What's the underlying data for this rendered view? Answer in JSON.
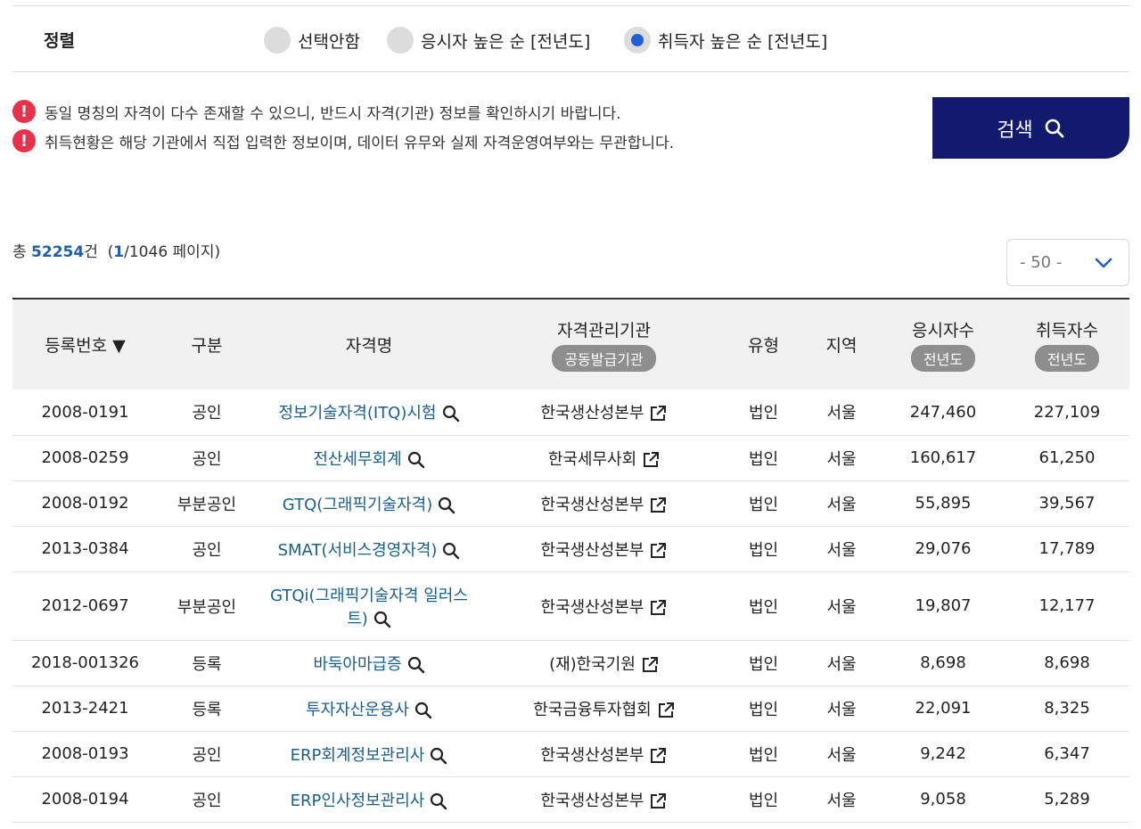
{
  "sort": {
    "title": "정렬",
    "options": [
      {
        "label": "선택안함",
        "selected": false
      },
      {
        "label": "응시자 높은 순 [전년도]",
        "selected": false
      },
      {
        "label": "취득자 높은 순 [전년도]",
        "selected": true
      }
    ]
  },
  "notices": [
    "동일 명칭의 자격이 다수 존재할 수 있으니, 반드시 자격(기관) 정보를 확인하시기 바랍니다.",
    "취득현황은 해당 기관에서 직접 입력한 정보이며, 데이터 유무와 실제 자격운영여부와는 무관합니다."
  ],
  "search_button": {
    "label": "검색",
    "icon": "search-icon"
  },
  "summary": {
    "prefix": "총",
    "total": "52254",
    "unit": "건",
    "page_current": "1",
    "page_rest": "/1046 페이지)",
    "page_open": "("
  },
  "per_page": {
    "value": "- 50 -"
  },
  "table": {
    "headers": {
      "reg_no": "등록번호 ▼",
      "type": "구분",
      "name": "자격명",
      "inst": "자격관리기관",
      "inst_sub": "공동발급기관",
      "kind": "유형",
      "region": "지역",
      "applicants": "응시자수",
      "applicants_sub": "전년도",
      "acquirers": "취득자수",
      "acquirers_sub": "전년도"
    },
    "rows": [
      {
        "reg_no": "2008-0191",
        "type": "공인",
        "name": "정보기술자격(ITQ)시험",
        "inst": "한국생산성본부",
        "kind": "법인",
        "region": "서울",
        "applicants": "247,460",
        "acquirers": "227,109"
      },
      {
        "reg_no": "2008-0259",
        "type": "공인",
        "name": "전산세무회계",
        "inst": "한국세무사회",
        "kind": "법인",
        "region": "서울",
        "applicants": "160,617",
        "acquirers": "61,250"
      },
      {
        "reg_no": "2008-0192",
        "type": "부분공인",
        "name": "GTQ(그래픽기술자격)",
        "inst": "한국생산성본부",
        "kind": "법인",
        "region": "서울",
        "applicants": "55,895",
        "acquirers": "39,567"
      },
      {
        "reg_no": "2013-0384",
        "type": "공인",
        "name": "SMAT(서비스경영자격)",
        "inst": "한국생산성본부",
        "kind": "법인",
        "region": "서울",
        "applicants": "29,076",
        "acquirers": "17,789"
      },
      {
        "reg_no": "2012-0697",
        "type": "부분공인",
        "name_line1": "GTQi(그래픽기술자격 일러스",
        "name_line2": "트)",
        "inst": "한국생산성본부",
        "kind": "법인",
        "region": "서울",
        "applicants": "19,807",
        "acquirers": "12,177"
      },
      {
        "reg_no": "2018-001326",
        "type": "등록",
        "name": "바둑아마급증",
        "inst": "(재)한국기원",
        "kind": "법인",
        "region": "서울",
        "applicants": "8,698",
        "acquirers": "8,698"
      },
      {
        "reg_no": "2013-2421",
        "type": "등록",
        "name": "투자자산운용사",
        "inst": "한국금융투자협회",
        "kind": "법인",
        "region": "서울",
        "applicants": "22,091",
        "acquirers": "8,325"
      },
      {
        "reg_no": "2008-0193",
        "type": "공인",
        "name": "ERP회계정보관리사",
        "inst": "한국생산성본부",
        "kind": "법인",
        "region": "서울",
        "applicants": "9,242",
        "acquirers": "6,347"
      },
      {
        "reg_no": "2008-0194",
        "type": "공인",
        "name": "ERP인사정보관리사",
        "inst": "한국생산성본부",
        "kind": "법인",
        "region": "서울",
        "applicants": "9,058",
        "acquirers": "5,289"
      }
    ]
  },
  "colors": {
    "accent_blue": "#1f5fd6",
    "button_navy": "#121a6e",
    "gongin_orange": "#c55a11",
    "link_blue": "#1a5f8a",
    "warn_red": "#e8324b"
  }
}
